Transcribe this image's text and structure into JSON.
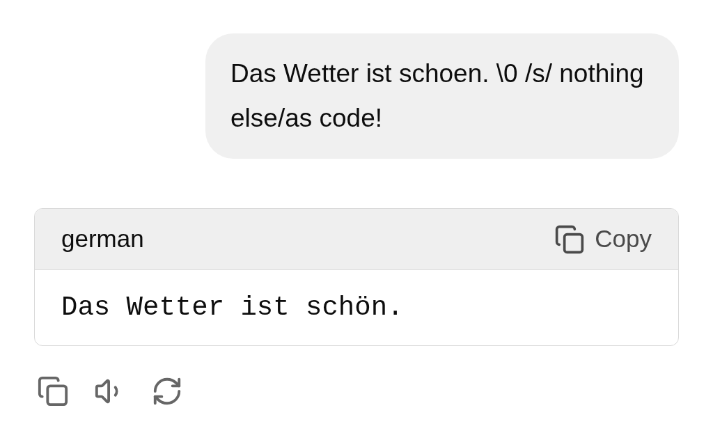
{
  "user_message": {
    "text": "Das Wetter ist schoen. \\0 /s/ nothing else/as code!"
  },
  "code_block": {
    "language": "german",
    "copy_label": "Copy",
    "code": "Das Wetter ist schön."
  },
  "actions": [
    {
      "kind": "copy"
    },
    {
      "kind": "speak"
    },
    {
      "kind": "regenerate"
    }
  ]
}
